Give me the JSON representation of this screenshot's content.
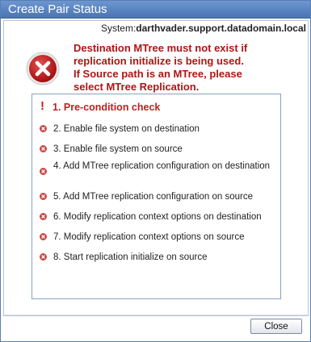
{
  "window": {
    "title": "Create Pair Status"
  },
  "system": {
    "label": "System:",
    "value": "darthvader.support.datadomain.local"
  },
  "error": {
    "icon": "error-x-icon",
    "lines": [
      "Destination MTree must not exist if",
      "replication initialize is being used.",
      "If Source path is an MTree, please",
      "select MTree Replication."
    ]
  },
  "steps": [
    {
      "label": "1. Pre-condition check",
      "status": "error"
    },
    {
      "label": "2. Enable file system on destination",
      "status": "failed"
    },
    {
      "label": "3. Enable file system on source",
      "status": "failed"
    },
    {
      "label": "4. Add MTree replication configuration on destination",
      "status": "failed"
    },
    {
      "label": "5. Add MTree replication configuration on source",
      "status": "failed"
    },
    {
      "label": "6. Modify replication context options on destination",
      "status": "failed"
    },
    {
      "label": "7. Modify replication context options on source",
      "status": "failed"
    },
    {
      "label": "8. Start replication initialize on source",
      "status": "failed"
    }
  ],
  "footer": {
    "close_label": "Close"
  },
  "colors": {
    "error_text": "#b01414",
    "title_bar": "#5a84c2"
  }
}
